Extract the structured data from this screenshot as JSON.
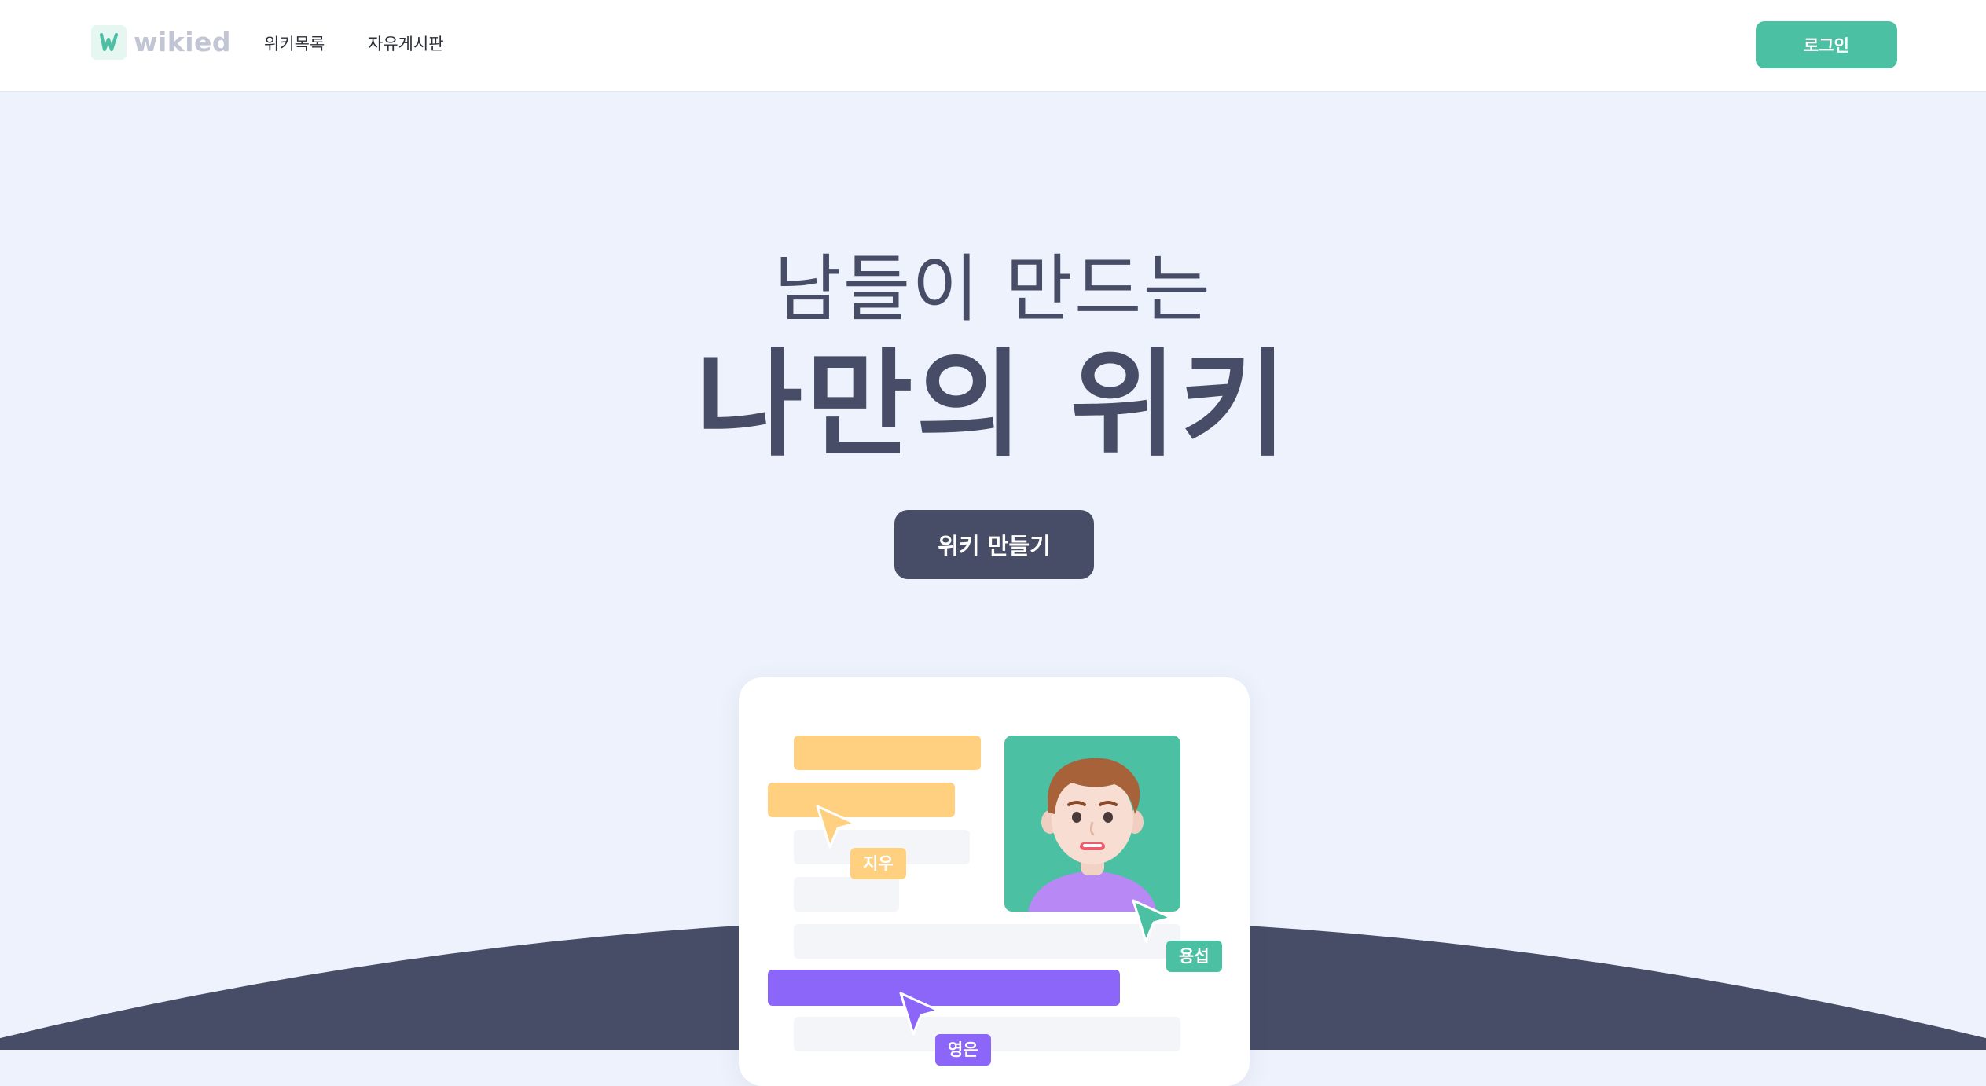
{
  "header": {
    "logo_text": "wikied",
    "nav": [
      "위키목록",
      "자유게시판"
    ],
    "login_label": "로그인"
  },
  "hero": {
    "subtitle": "남들이 만드는",
    "title": "나만의 위키",
    "cta_label": "위키 만들기"
  },
  "illustration": {
    "tags": {
      "yellow": "지우",
      "green": "용섭",
      "purple": "영은"
    }
  },
  "colors": {
    "brand_green": "#4cc0a3",
    "navy": "#474d66",
    "background": "#eef2fc",
    "yellow": "#fed07f",
    "purple": "#8b66f8"
  }
}
